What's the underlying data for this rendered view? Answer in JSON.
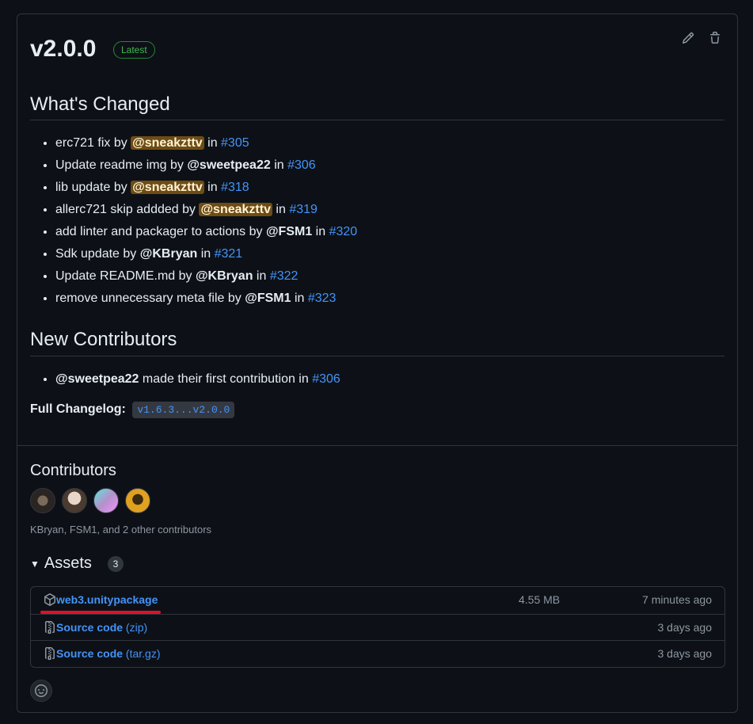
{
  "release": {
    "title": "v2.0.0",
    "badge": "Latest"
  },
  "whats_changed": {
    "heading": "What's Changed",
    "items": [
      {
        "text": "erc721 fix by ",
        "user": "@sneakzttv",
        "highlight": true,
        "in": " in ",
        "pr": "#305"
      },
      {
        "text": "Update readme img by ",
        "user": "@sweetpea22",
        "highlight": false,
        "in": " in ",
        "pr": "#306"
      },
      {
        "text": "lib update by ",
        "user": "@sneakzttv",
        "highlight": true,
        "in": " in ",
        "pr": "#318"
      },
      {
        "text": "allerc721 skip addded by ",
        "user": "@sneakzttv",
        "highlight": true,
        "in": " in ",
        "pr": "#319"
      },
      {
        "text": "add linter and packager to actions by ",
        "user": "@FSM1",
        "highlight": false,
        "in": " in ",
        "pr": "#320"
      },
      {
        "text": "Sdk update by ",
        "user": "@KBryan",
        "highlight": false,
        "in": " in ",
        "pr": "#321"
      },
      {
        "text": "Update README.md by ",
        "user": "@KBryan",
        "highlight": false,
        "in": " in ",
        "pr": "#322"
      },
      {
        "text": "remove unnecessary meta file by ",
        "user": "@FSM1",
        "highlight": false,
        "in": " in ",
        "pr": "#323"
      }
    ]
  },
  "new_contributors": {
    "heading": "New Contributors",
    "items": [
      {
        "user": "@sweetpea22",
        "text": " made their first contribution in ",
        "pr": "#306"
      }
    ]
  },
  "changelog": {
    "label": "Full Changelog:",
    "range": "v1.6.3...v2.0.0"
  },
  "contributors": {
    "heading": "Contributors",
    "summary": "KBryan, FSM1, and 2 other contributors"
  },
  "assets": {
    "heading": "Assets",
    "count": "3",
    "rows": [
      {
        "name": "web3.unitypackage",
        "ext": "",
        "size": "4.55 MB",
        "time": "7 minutes ago",
        "icon": "package-icon"
      },
      {
        "name": "Source code",
        "ext": " (zip)",
        "size": "",
        "time": "3 days ago",
        "icon": "file-zip-icon"
      },
      {
        "name": "Source code",
        "ext": " (tar.gz)",
        "size": "",
        "time": "3 days ago",
        "icon": "file-zip-icon"
      }
    ]
  },
  "colors": {
    "accent": "#4493f8",
    "badge_green": "#3fb950",
    "mention_highlight": "#6e4c14",
    "annotation_red": "#e0102a"
  }
}
